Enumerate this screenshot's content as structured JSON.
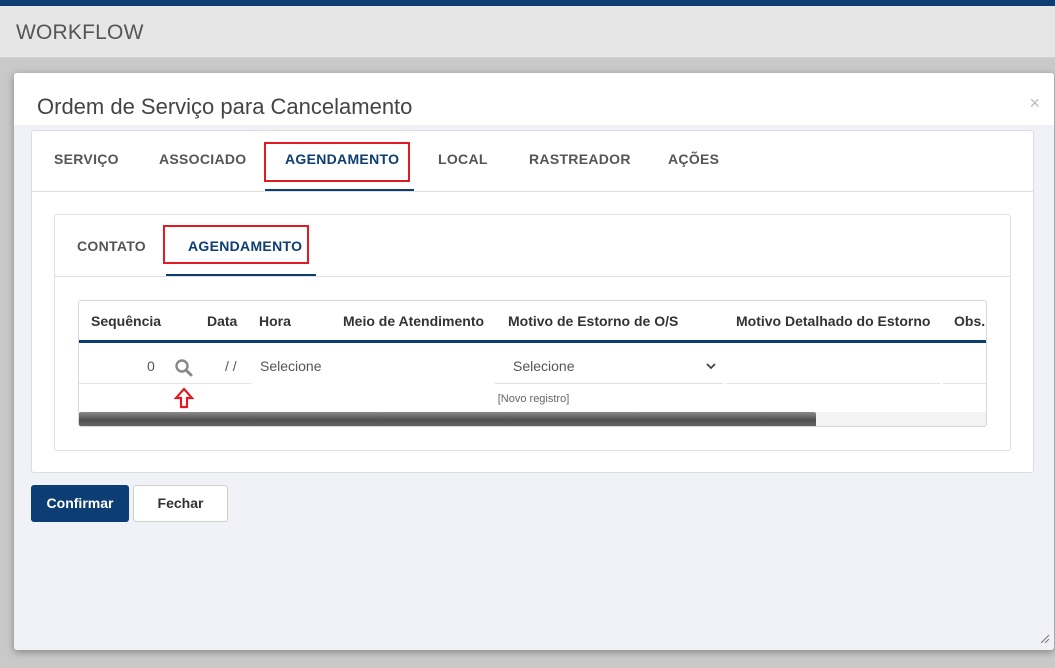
{
  "header": {
    "title": "WORKFLOW"
  },
  "modal": {
    "title": "Ordem de Serviço para Cancelamento",
    "close_label": "×"
  },
  "main_tabs": [
    {
      "label": "SERVIÇO",
      "active": false
    },
    {
      "label": "ASSOCIADO",
      "active": false
    },
    {
      "label": "AGENDAMENTO",
      "active": true
    },
    {
      "label": "LOCAL",
      "active": false
    },
    {
      "label": "RASTREADOR",
      "active": false
    },
    {
      "label": "AÇÕES",
      "active": false
    }
  ],
  "sub_tabs": [
    {
      "label": "CONTATO",
      "active": false
    },
    {
      "label": "AGENDAMENTO",
      "active": true
    }
  ],
  "grid": {
    "columns": [
      "Sequência",
      "Data",
      "Hora",
      "Meio de Atendimento",
      "Motivo de Estorno de O/S",
      "Motivo Detalhado do Estorno",
      "Obs."
    ],
    "rows": [
      {
        "sequencia": "0",
        "data": "/ /",
        "hora": "Selecione",
        "motivo_estorno": "Selecione"
      }
    ],
    "new_record_label": "[Novo registro]"
  },
  "buttons": {
    "confirm": "Confirmar",
    "close": "Fechar"
  },
  "colors": {
    "accent": "#0c3d73",
    "highlight": "#e01b24"
  },
  "icons": [
    "search-icon",
    "arrow-up-icon",
    "chevron-down-icon",
    "resize-grip-icon"
  ]
}
